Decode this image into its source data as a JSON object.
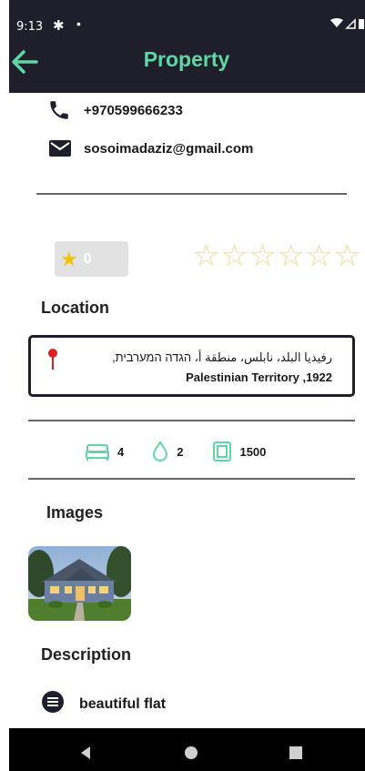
{
  "status_bar": {
    "time": "9:13"
  },
  "app_bar": {
    "title": "Property"
  },
  "contact": {
    "phone": "+970599666233",
    "email": "sosoimadaziz@gmail.com"
  },
  "rating": {
    "average": "0",
    "stars_filled": 0,
    "stars_total": 6
  },
  "location": {
    "heading": "Location",
    "address_line1": "رفيديا البلد، نابلس، منطقة أ، הגדה המערבית,",
    "address_line2": "Palestinian Territory ,1922"
  },
  "features": {
    "beds": "4",
    "baths": "2",
    "area": "1500"
  },
  "images": {
    "heading": "Images"
  },
  "description": {
    "heading": "Description",
    "text": "beautiful flat"
  },
  "colors": {
    "accent": "#5fd6a5",
    "dark": "#1f1f2b",
    "star": "#f0c400"
  }
}
